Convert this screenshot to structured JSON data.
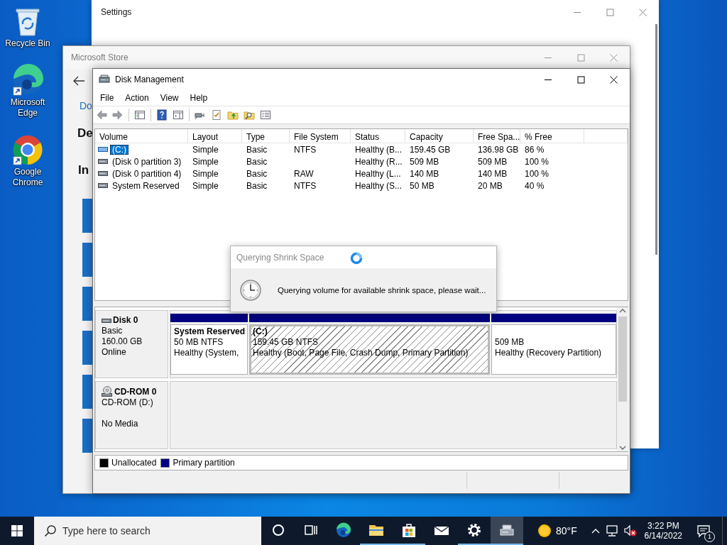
{
  "desktop_icons": [
    {
      "label": "Recycle Bin",
      "kind": "recycle-bin",
      "shortcut": false
    },
    {
      "label": "Microsoft Edge",
      "kind": "edge",
      "shortcut": true
    },
    {
      "label": "Google Chrome",
      "kind": "chrome",
      "shortcut": true
    }
  ],
  "settings_window": {
    "title": "Settings"
  },
  "store_window": {
    "title": "Microsoft Store",
    "link": "Do",
    "heading": "De",
    "subheading": "In"
  },
  "disk_management": {
    "title": "Disk Management",
    "menu": [
      "File",
      "Action",
      "View",
      "Help"
    ],
    "volume_list": {
      "columns": [
        "Volume",
        "Layout",
        "Type",
        "File System",
        "Status",
        "Capacity",
        "Free Spa...",
        "% Free"
      ],
      "rows": [
        {
          "kind": "striped",
          "selected": true,
          "volume": "(C:)",
          "layout": "Simple",
          "type": "Basic",
          "file_system": "NTFS",
          "status": "Healthy (B...",
          "capacity": "159.45 GB",
          "free_space": "136.98 GB",
          "percent_free": "86 %"
        },
        {
          "kind": "plain",
          "selected": false,
          "volume": "(Disk 0 partition 3)",
          "layout": "Simple",
          "type": "Basic",
          "status": "Healthy (R...",
          "capacity": "509 MB",
          "free_space": "509 MB",
          "percent_free": "100 %"
        },
        {
          "kind": "plain",
          "selected": false,
          "volume": "(Disk 0 partition 4)",
          "layout": "Simple",
          "type": "Basic",
          "file_system": "RAW",
          "status": "Healthy (L...",
          "capacity": "140 MB",
          "free_space": "140 MB",
          "percent_free": "100 %"
        },
        {
          "kind": "plain",
          "selected": false,
          "volume": "System Reserved",
          "layout": "Simple",
          "type": "Basic",
          "file_system": "NTFS",
          "status": "Healthy (S...",
          "capacity": "50 MB",
          "free_space": "20 MB",
          "percent_free": "40 %"
        }
      ]
    },
    "disks": [
      {
        "kind": "disk",
        "name": "Disk 0",
        "lines": [
          "Basic",
          "160.00 GB",
          "Online"
        ],
        "partitions": [
          {
            "name": "System Reserved",
            "selected": false,
            "details": [
              "50 MB NTFS",
              "Healthy (System,"
            ]
          },
          {
            "name": "(C:)",
            "selected": true,
            "details": [
              "159.45 GB NTFS",
              "Healthy (Boot, Page File, Crash Dump, Primary Partition)"
            ]
          },
          {
            "selected": false,
            "details": [
              "509 MB",
              "Healthy (Recovery Partition)"
            ]
          }
        ]
      },
      {
        "kind": "cdrom",
        "name": "CD-ROM 0",
        "lines": [
          "CD-ROM (D:)",
          "No Media"
        ]
      }
    ],
    "legend": [
      {
        "label": "Unallocated",
        "color": "#000000"
      },
      {
        "label": "Primary partition",
        "color": "#000080"
      }
    ]
  },
  "dialog": {
    "title": "Querying Shrink Space",
    "message": "Querying volume for available shrink space, please wait..."
  },
  "taskbar": {
    "search": {
      "placeholder": "Type here to search"
    },
    "apps": [
      {
        "kind": "cortana",
        "running": false,
        "selected": false
      },
      {
        "kind": "task-view",
        "running": false,
        "selected": false
      },
      {
        "kind": "edge",
        "running": false,
        "selected": false
      },
      {
        "kind": "explorer",
        "running": true,
        "selected": false
      },
      {
        "kind": "store",
        "running": true,
        "selected": false
      },
      {
        "kind": "mail",
        "running": false,
        "selected": false
      },
      {
        "kind": "settings",
        "running": true,
        "selected": false
      },
      {
        "kind": "disk-management",
        "running": true,
        "selected": true
      }
    ],
    "weather": "80°F",
    "time": "3:22 PM",
    "date": "6/14/2022",
    "notifications": "1"
  }
}
